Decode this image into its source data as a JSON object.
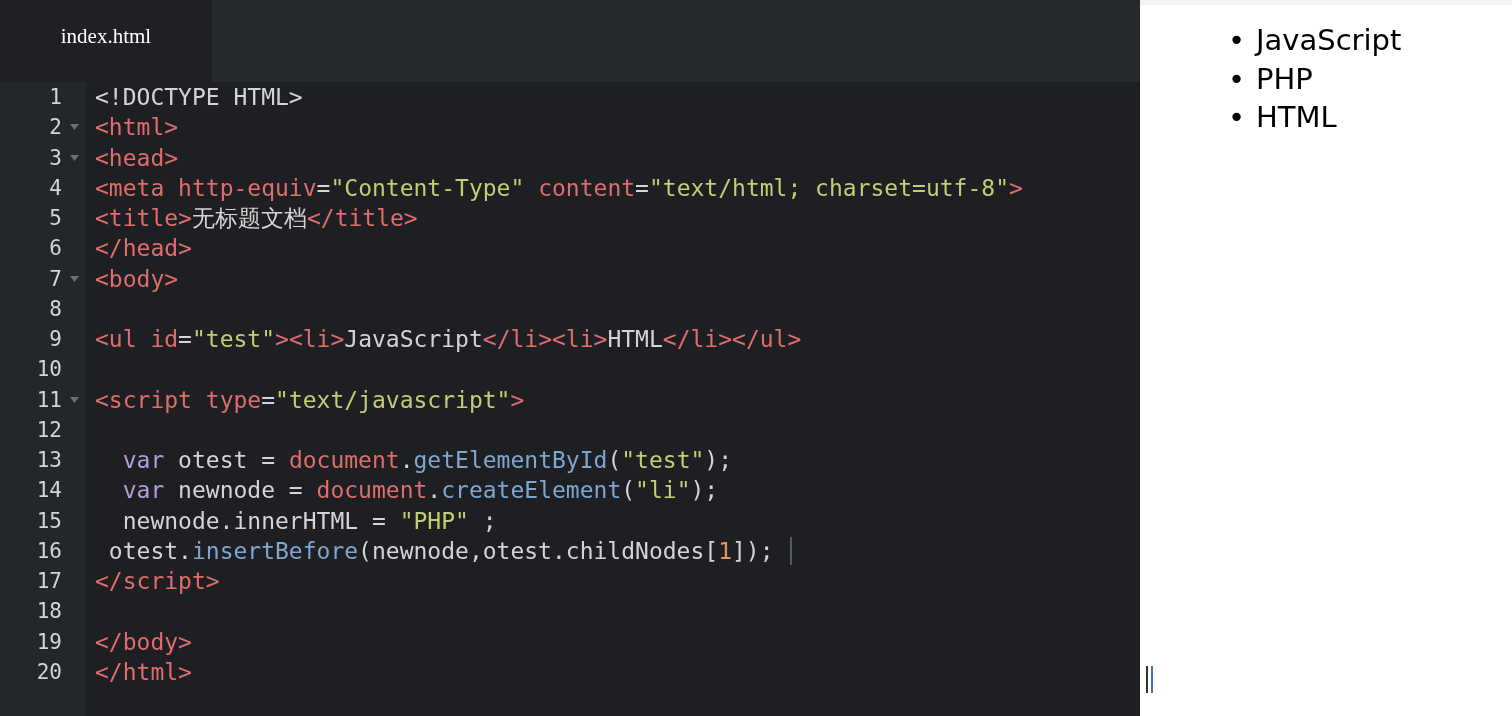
{
  "tabs": [
    {
      "label": "index.html",
      "selected": true
    }
  ],
  "editor": {
    "lines": [
      {
        "number": "1",
        "foldable": false,
        "cursor": false,
        "tokens": [
          {
            "kind": "plain",
            "text": "<!DOCTYPE HTML>"
          }
        ]
      },
      {
        "number": "2",
        "foldable": true,
        "cursor": false,
        "tokens": [
          {
            "kind": "tag",
            "text": "<html>"
          }
        ]
      },
      {
        "number": "3",
        "foldable": true,
        "cursor": false,
        "tokens": [
          {
            "kind": "tag",
            "text": "<head>"
          }
        ]
      },
      {
        "number": "4",
        "foldable": false,
        "cursor": false,
        "tokens": [
          {
            "kind": "tag",
            "text": "<meta "
          },
          {
            "kind": "attr",
            "text": "http-equiv"
          },
          {
            "kind": "plain",
            "text": "="
          },
          {
            "kind": "str",
            "text": "\"Content-Type\""
          },
          {
            "kind": "attr",
            "text": " content"
          },
          {
            "kind": "plain",
            "text": "="
          },
          {
            "kind": "str",
            "text": "\"text/html; charset=utf-8\""
          },
          {
            "kind": "tag",
            "text": ">"
          }
        ]
      },
      {
        "number": "5",
        "foldable": false,
        "cursor": false,
        "tokens": [
          {
            "kind": "tag",
            "text": "<title>"
          },
          {
            "kind": "plain",
            "text": "无标题文档"
          },
          {
            "kind": "tag",
            "text": "</title>"
          }
        ]
      },
      {
        "number": "6",
        "foldable": false,
        "cursor": false,
        "tokens": [
          {
            "kind": "tag",
            "text": "</head>"
          }
        ]
      },
      {
        "number": "7",
        "foldable": true,
        "cursor": false,
        "tokens": [
          {
            "kind": "tag",
            "text": "<body>"
          }
        ]
      },
      {
        "number": "8",
        "foldable": false,
        "cursor": false
      },
      {
        "number": "9",
        "foldable": false,
        "cursor": false,
        "tokens": [
          {
            "kind": "tag",
            "text": "<ul "
          },
          {
            "kind": "attr",
            "text": "id"
          },
          {
            "kind": "plain",
            "text": "="
          },
          {
            "kind": "str",
            "text": "\"test\""
          },
          {
            "kind": "tag",
            "text": "><li>"
          },
          {
            "kind": "plain",
            "text": "JavaScript"
          },
          {
            "kind": "tag",
            "text": "</li><li>"
          },
          {
            "kind": "plain",
            "text": "HTML"
          },
          {
            "kind": "tag",
            "text": "</li></ul>"
          }
        ]
      },
      {
        "number": "10",
        "foldable": false,
        "cursor": false
      },
      {
        "number": "11",
        "foldable": true,
        "cursor": false,
        "tokens": [
          {
            "kind": "tag",
            "text": "<script "
          },
          {
            "kind": "attr",
            "text": "type"
          },
          {
            "kind": "plain",
            "text": "="
          },
          {
            "kind": "str",
            "text": "\"text/javascript\""
          },
          {
            "kind": "tag",
            "text": ">"
          }
        ]
      },
      {
        "number": "12",
        "foldable": false,
        "cursor": false
      },
      {
        "number": "13",
        "foldable": false,
        "cursor": false,
        "tokens": [
          {
            "kind": "kw",
            "text": "  var"
          },
          {
            "kind": "plain",
            "text": " otest = "
          },
          {
            "kind": "obj",
            "text": "document"
          },
          {
            "kind": "plain",
            "text": "."
          },
          {
            "kind": "fn",
            "text": "getElementById"
          },
          {
            "kind": "plain",
            "text": "("
          },
          {
            "kind": "str",
            "text": "\"test\""
          },
          {
            "kind": "plain",
            "text": ");"
          }
        ]
      },
      {
        "number": "14",
        "foldable": false,
        "cursor": false,
        "tokens": [
          {
            "kind": "kw",
            "text": "  var"
          },
          {
            "kind": "plain",
            "text": " newnode = "
          },
          {
            "kind": "obj",
            "text": "document"
          },
          {
            "kind": "plain",
            "text": "."
          },
          {
            "kind": "fn",
            "text": "createElement"
          },
          {
            "kind": "plain",
            "text": "("
          },
          {
            "kind": "str",
            "text": "\"li\""
          },
          {
            "kind": "plain",
            "text": ");"
          }
        ]
      },
      {
        "number": "15",
        "foldable": false,
        "cursor": false,
        "tokens": [
          {
            "kind": "plain",
            "text": "  newnode.innerHTML = "
          },
          {
            "kind": "str",
            "text": "\"PHP\""
          },
          {
            "kind": "plain",
            "text": " ;"
          }
        ]
      },
      {
        "number": "16",
        "foldable": false,
        "cursor": true,
        "tokens": [
          {
            "kind": "plain",
            "text": " otest."
          },
          {
            "kind": "fn",
            "text": "insertBefore"
          },
          {
            "kind": "plain",
            "text": "(newnode,otest.childNodes["
          },
          {
            "kind": "num",
            "text": "1"
          },
          {
            "kind": "plain",
            "text": "]);"
          }
        ]
      },
      {
        "number": "17",
        "foldable": false,
        "cursor": false,
        "tokens": [
          {
            "kind": "tag",
            "text": "</script>"
          }
        ]
      },
      {
        "number": "18",
        "foldable": false,
        "cursor": false
      },
      {
        "number": "19",
        "foldable": false,
        "cursor": false,
        "tokens": [
          {
            "kind": "tag",
            "text": "</body>"
          }
        ]
      },
      {
        "number": "20",
        "foldable": false,
        "cursor": false,
        "tokens": [
          {
            "kind": "tag",
            "text": "</html>"
          }
        ]
      }
    ]
  },
  "preview": {
    "list": [
      {
        "bullet": "•",
        "text": "JavaScript"
      },
      {
        "bullet": "•",
        "text": "PHP"
      },
      {
        "bullet": "•",
        "text": "HTML"
      }
    ]
  }
}
